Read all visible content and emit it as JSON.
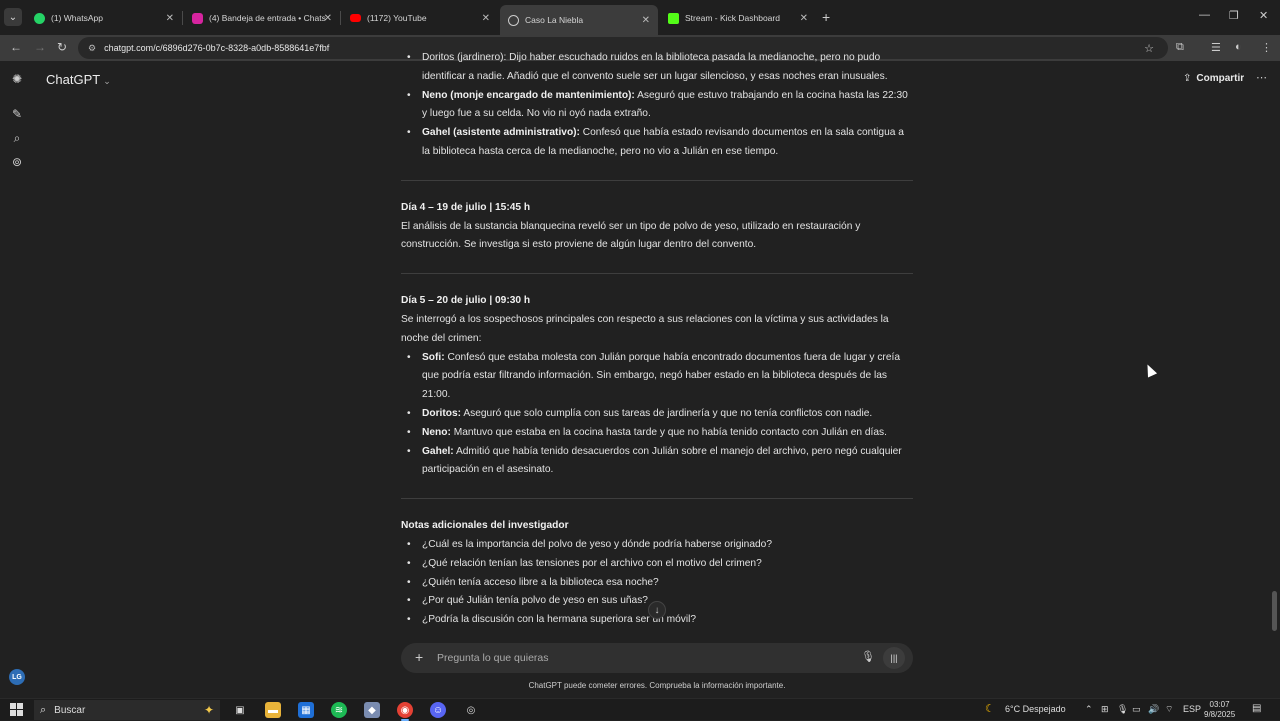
{
  "browser": {
    "tabs": [
      {
        "title": "(1) WhatsApp",
        "icon": "whatsapp-icon",
        "color": "#25d366"
      },
      {
        "title": "(4) Bandeja de entrada • Chats",
        "icon": "instagram-icon",
        "color": "#d6249f"
      },
      {
        "title": "(1172) YouTube",
        "icon": "youtube-icon",
        "color": "#ff0000"
      },
      {
        "title": "Caso La Niebla",
        "icon": "chatgpt-icon",
        "color": "#cccccc"
      },
      {
        "title": "Stream - Kick Dashboard",
        "icon": "kick-icon",
        "color": "#53fc18"
      }
    ],
    "new_tab_glyph": "+",
    "url": "chatgpt.com/c/6896d276-0b7c-8328-a0db-8588641e7fbf"
  },
  "app": {
    "model_name": "ChatGPT",
    "share_label": "Compartir",
    "avatar_initials": "LG"
  },
  "conversation": {
    "top_partial": {
      "cut_line": "Doritos (jardinero): Dijo haber escuchado ruidos en la biblioteca pasada la medianoche, pero no pudo",
      "cont": "identificar a nadie. Añadió que el convento suele ser un lugar silencioso, y esas noches eran inusuales.",
      "items": [
        {
          "name": "Neno (monje encargado de mantenimiento):",
          "text": " Aseguró que estuvo trabajando en la cocina hasta las 22:30 y luego fue a su celda. No vio ni oyó nada extraño."
        },
        {
          "name": "Gahel (asistente administrativo):",
          "text": " Confesó que había estado revisando documentos en la sala contigua a la biblioteca hasta cerca de la medianoche, pero no vio a Julián en ese tiempo."
        }
      ]
    },
    "day4": {
      "heading": "Día 4 – 19 de julio | 15:45 h",
      "body": "El análisis de la sustancia blanquecina reveló ser un tipo de polvo de yeso, utilizado en restauración y construcción. Se investiga si esto proviene de algún lugar dentro del convento."
    },
    "day5": {
      "heading": "Día 5 – 20 de julio | 09:30 h",
      "intro": "Se interrogó a los sospechosos principales con respecto a sus relaciones con la víctima y sus actividades la noche del crimen:",
      "items": [
        {
          "name": "Sofi:",
          "text": " Confesó que estaba molesta con Julián porque había encontrado documentos fuera de lugar y creía que podría estar filtrando información. Sin embargo, negó haber estado en la biblioteca después de las 21:00."
        },
        {
          "name": "Doritos:",
          "text": " Aseguró que solo cumplía con sus tareas de jardinería y que no tenía conflictos con nadie."
        },
        {
          "name": "Neno:",
          "text": " Mantuvo que estaba en la cocina hasta tarde y que no había tenido contacto con Julián en días."
        },
        {
          "name": "Gahel:",
          "text": " Admitió que había tenido desacuerdos con Julián sobre el manejo del archivo, pero negó cualquier participación en el asesinato."
        }
      ]
    },
    "notes": {
      "heading": "Notas adicionales del investigador",
      "items": [
        "¿Cuál es la importancia del polvo de yeso y dónde podría haberse originado?",
        "¿Qué relación tenían las tensiones por el archivo con el motivo del crimen?",
        "¿Quién tenía acceso libre a la biblioteca esa noche?",
        "¿Por qué Julián tenía polvo de yeso en sus uñas?",
        "¿Podría la discusión con la hermana superiora ser un móvil?"
      ]
    }
  },
  "composer": {
    "placeholder": "Pregunta lo que quieras",
    "disclaimer": "ChatGPT puede cometer errores. Comprueba la información importante."
  },
  "taskbar": {
    "search_label": "Buscar",
    "weather": "6°C  Despejado",
    "language": "ESP",
    "time": "03:07",
    "date": "9/8/2025"
  }
}
